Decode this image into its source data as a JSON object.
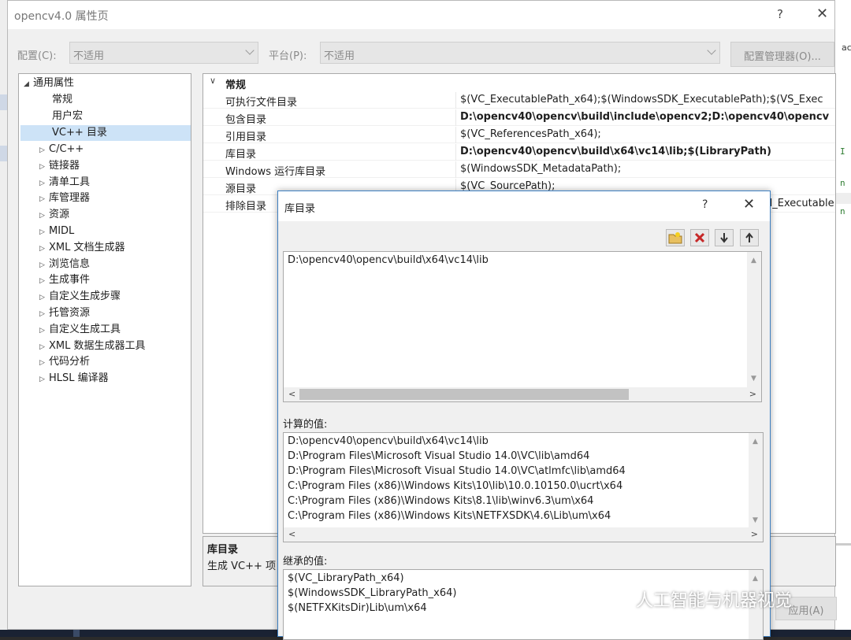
{
  "window": {
    "title": "opencv4.0 属性页",
    "help_label": "?",
    "close_label": "✕"
  },
  "config": {
    "config_label": "配置(C):",
    "config_value": "不适用",
    "platform_label": "平台(P):",
    "platform_value": "不适用",
    "manager_button": "配置管理器(O)..."
  },
  "tree": {
    "root": "通用属性",
    "children": [
      "常规",
      "用户宏",
      "VC++ 目录"
    ],
    "items": [
      "C/C++",
      "链接器",
      "清单工具",
      "库管理器",
      "资源",
      "MIDL",
      "XML 文档生成器",
      "浏览信息",
      "生成事件",
      "自定义生成步骤",
      "托管资源",
      "自定义生成工具",
      "XML 数据生成器工具",
      "代码分析",
      "HLSL 编译器"
    ]
  },
  "grid": {
    "section": "常规",
    "rows": [
      {
        "name": "可执行文件目录",
        "value": "$(VC_ExecutablePath_x64);$(WindowsSDK_ExecutablePath);$(VS_Exec"
      },
      {
        "name": "包含目录",
        "value": "D:\\opencv40\\opencv\\build\\include\\opencv2;D:\\opencv40\\opencv"
      },
      {
        "name": "引用目录",
        "value": "$(VC_ReferencesPath_x64);"
      },
      {
        "name": "库目录",
        "value": "D:\\opencv40\\opencv\\build\\x64\\vc14\\lib;$(LibraryPath)"
      },
      {
        "name": "Windows 运行库目录",
        "value": "$(WindowsSDK_MetadataPath);"
      },
      {
        "name": "源目录",
        "value": "$(VC_SourcePath);"
      },
      {
        "name": "排除目录",
        "value": "d_Executable"
      }
    ]
  },
  "description": {
    "title": "库目录",
    "text": "生成 VC++ 项"
  },
  "bottom_button": "应用(A)",
  "dialog": {
    "title": "库目录",
    "help_label": "?",
    "close_label": "✕",
    "tools": [
      "new-folder",
      "delete",
      "move-down",
      "move-up"
    ],
    "entry": "D:\\opencv40\\opencv\\build\\x64\\vc14\\lib",
    "computed_label": "计算的值:",
    "computed": [
      "D:\\opencv40\\opencv\\build\\x64\\vc14\\lib",
      "D:\\Program Files\\Microsoft Visual Studio 14.0\\VC\\lib\\amd64",
      "D:\\Program Files\\Microsoft Visual Studio 14.0\\VC\\atlmfc\\lib\\amd64",
      "C:\\Program Files (x86)\\Windows Kits\\10\\lib\\10.0.10150.0\\ucrt\\x64",
      "C:\\Program Files (x86)\\Windows Kits\\8.1\\lib\\winv6.3\\um\\x64",
      "C:\\Program Files (x86)\\Windows Kits\\NETFXSDK\\4.6\\Lib\\um\\x64"
    ],
    "inherited_label": "继承的值:",
    "inherited": [
      "$(VC_LibraryPath_x64)",
      "$(WindowsSDK_LibraryPath_x64)",
      "$(NETFXKitsDir)Lib\\um\\x64"
    ]
  },
  "watermark": "人工智能与机器视觉",
  "background": {
    "fragments": [
      "ac",
      "I",
      "n",
      "n"
    ]
  },
  "colors": {
    "selection": "#cde3f7",
    "dialog_border": "#3d7fc1",
    "code_green": "#2e7d32"
  }
}
